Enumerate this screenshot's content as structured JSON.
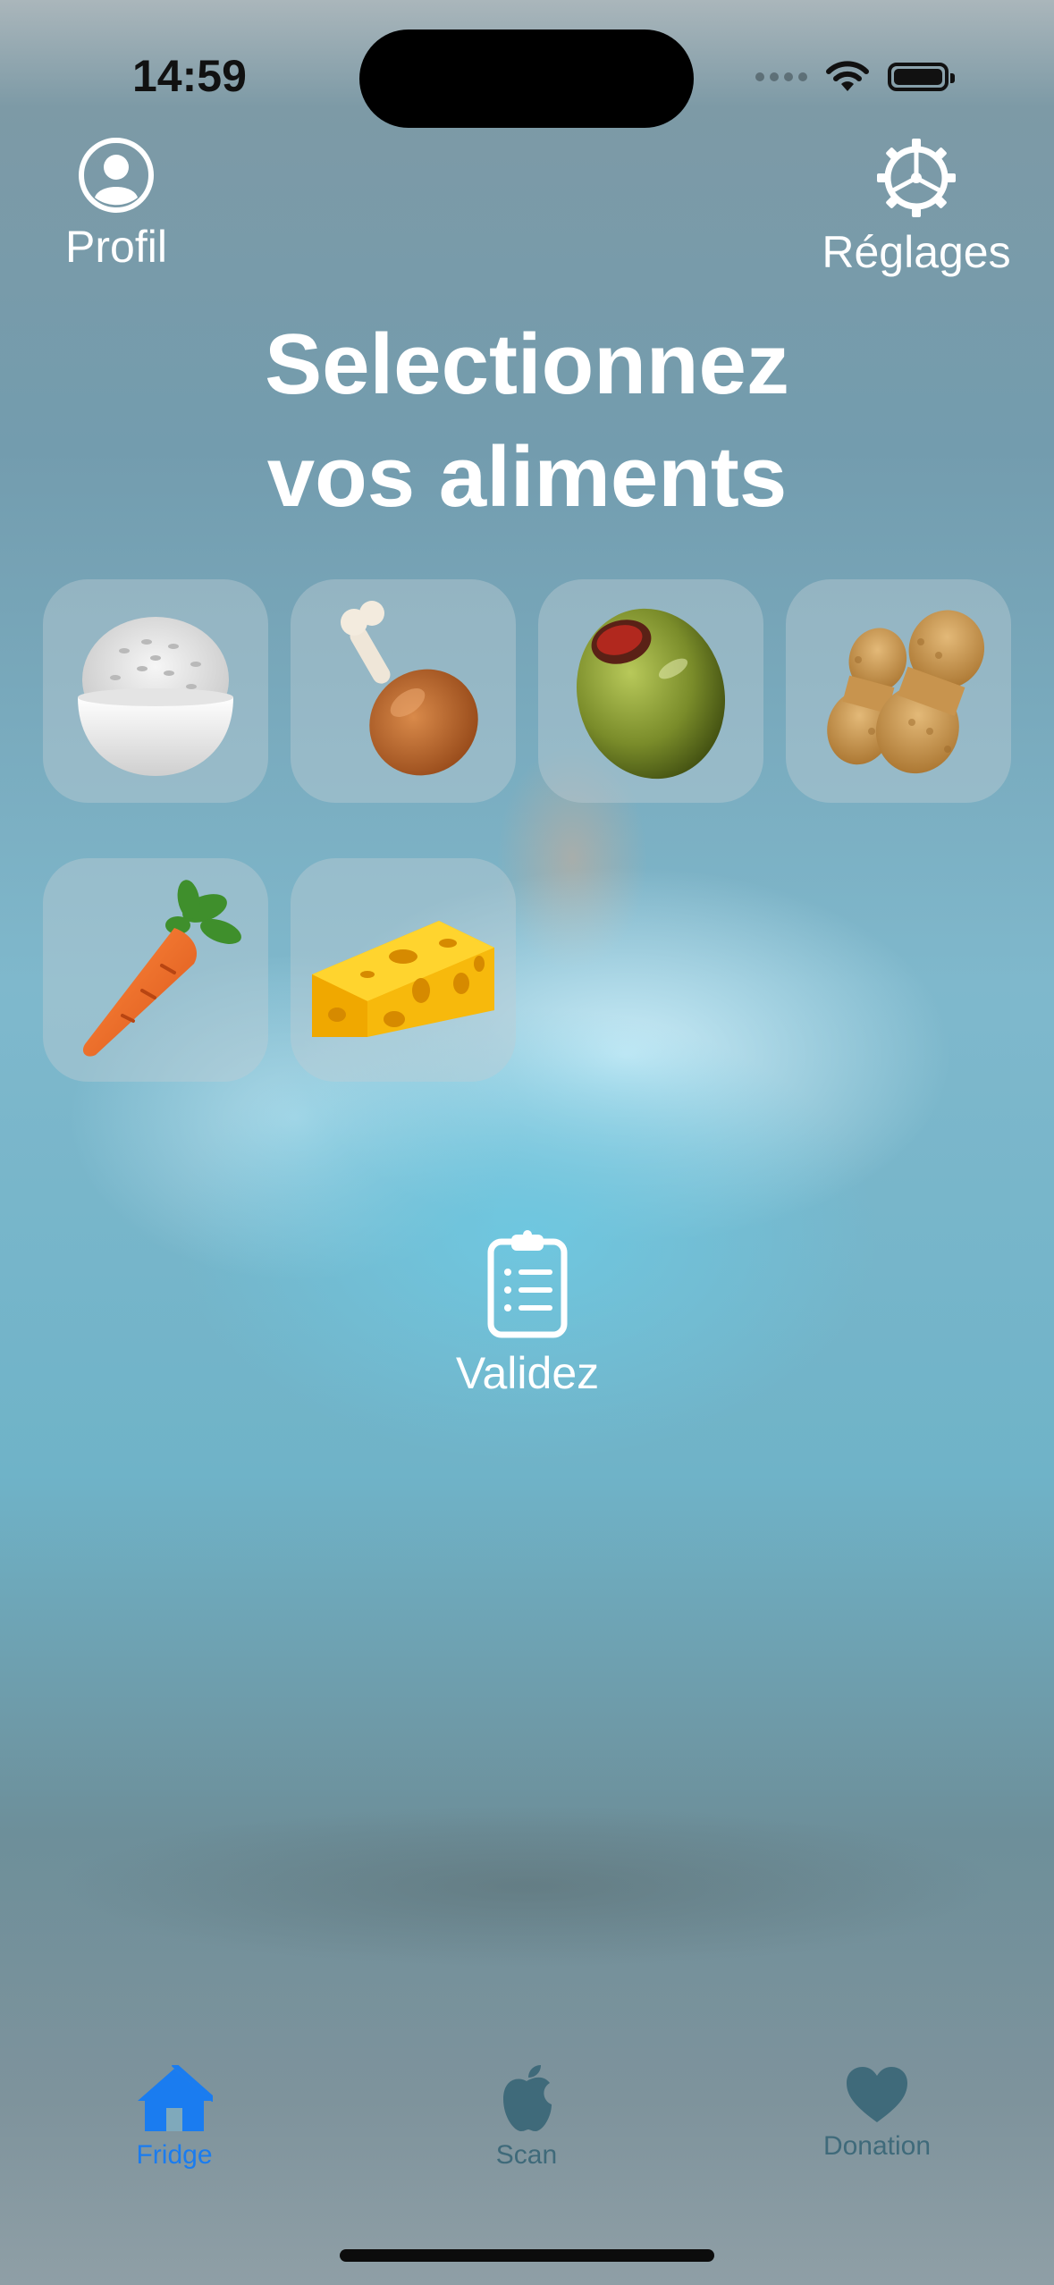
{
  "status_bar": {
    "time": "14:59"
  },
  "header": {
    "profile_label": "Profil",
    "settings_label": "Réglages"
  },
  "title": {
    "line1": "Selectionnez",
    "line2": "vos aliments"
  },
  "foods": [
    {
      "name": "rice-bowl-icon"
    },
    {
      "name": "chicken-drumstick-icon"
    },
    {
      "name": "olive-icon"
    },
    {
      "name": "peanuts-icon"
    },
    {
      "name": "carrot-icon"
    },
    {
      "name": "cheese-icon"
    }
  ],
  "validate": {
    "label": "Validez",
    "icon": "clipboard-list-icon"
  },
  "tabbar": {
    "tabs": [
      {
        "label": "Fridge",
        "icon": "house-icon",
        "active": true
      },
      {
        "label": "Scan",
        "icon": "apple-icon",
        "active": false
      },
      {
        "label": "Donation",
        "icon": "heart-icon",
        "active": false
      }
    ]
  },
  "colors": {
    "accent": "#1a7cf0",
    "inactive_tab": "#3f6a7a",
    "text_light": "#ffffff"
  }
}
